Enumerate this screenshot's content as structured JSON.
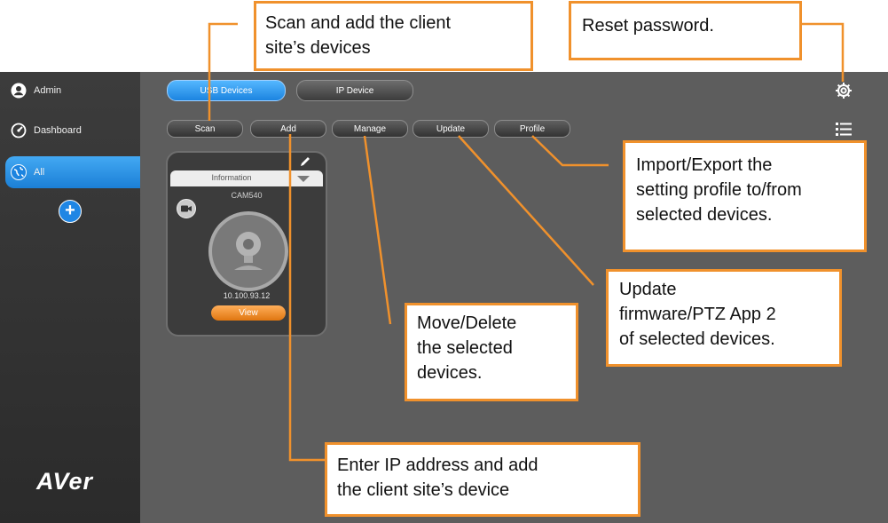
{
  "sidebar": {
    "admin_label": "Admin",
    "dashboard_label": "Dashboard",
    "all_label": "All",
    "add_icon": "plus-icon",
    "logo_text": "AVer"
  },
  "tabs": {
    "usb": "USB Devices",
    "ip": "IP Device"
  },
  "toolbar": {
    "scan": "Scan",
    "add": "Add",
    "manage": "Manage",
    "update": "Update",
    "profile": "Profile"
  },
  "device_card": {
    "tab_label": "Information",
    "camera_name": "CAM540",
    "ip_address": "10.100.93.12",
    "view_button": "View"
  },
  "callouts": {
    "scan": [
      "Scan and add the client",
      "site’s devices"
    ],
    "reset": [
      "Reset password."
    ],
    "profile": [
      "Import/Export the",
      "setting profile to/from",
      "selected devices."
    ],
    "update": [
      "Update",
      "firmware/PTZ App 2",
      "of selected devices."
    ],
    "manage": [
      "Move/Delete",
      "the selected",
      "devices."
    ],
    "add": [
      "Enter IP address and add",
      "the client site’s device"
    ]
  },
  "colors": {
    "accent_blue": "#1c84e0",
    "callout_orange": "#f0912c",
    "view_orange": "#e07610"
  }
}
